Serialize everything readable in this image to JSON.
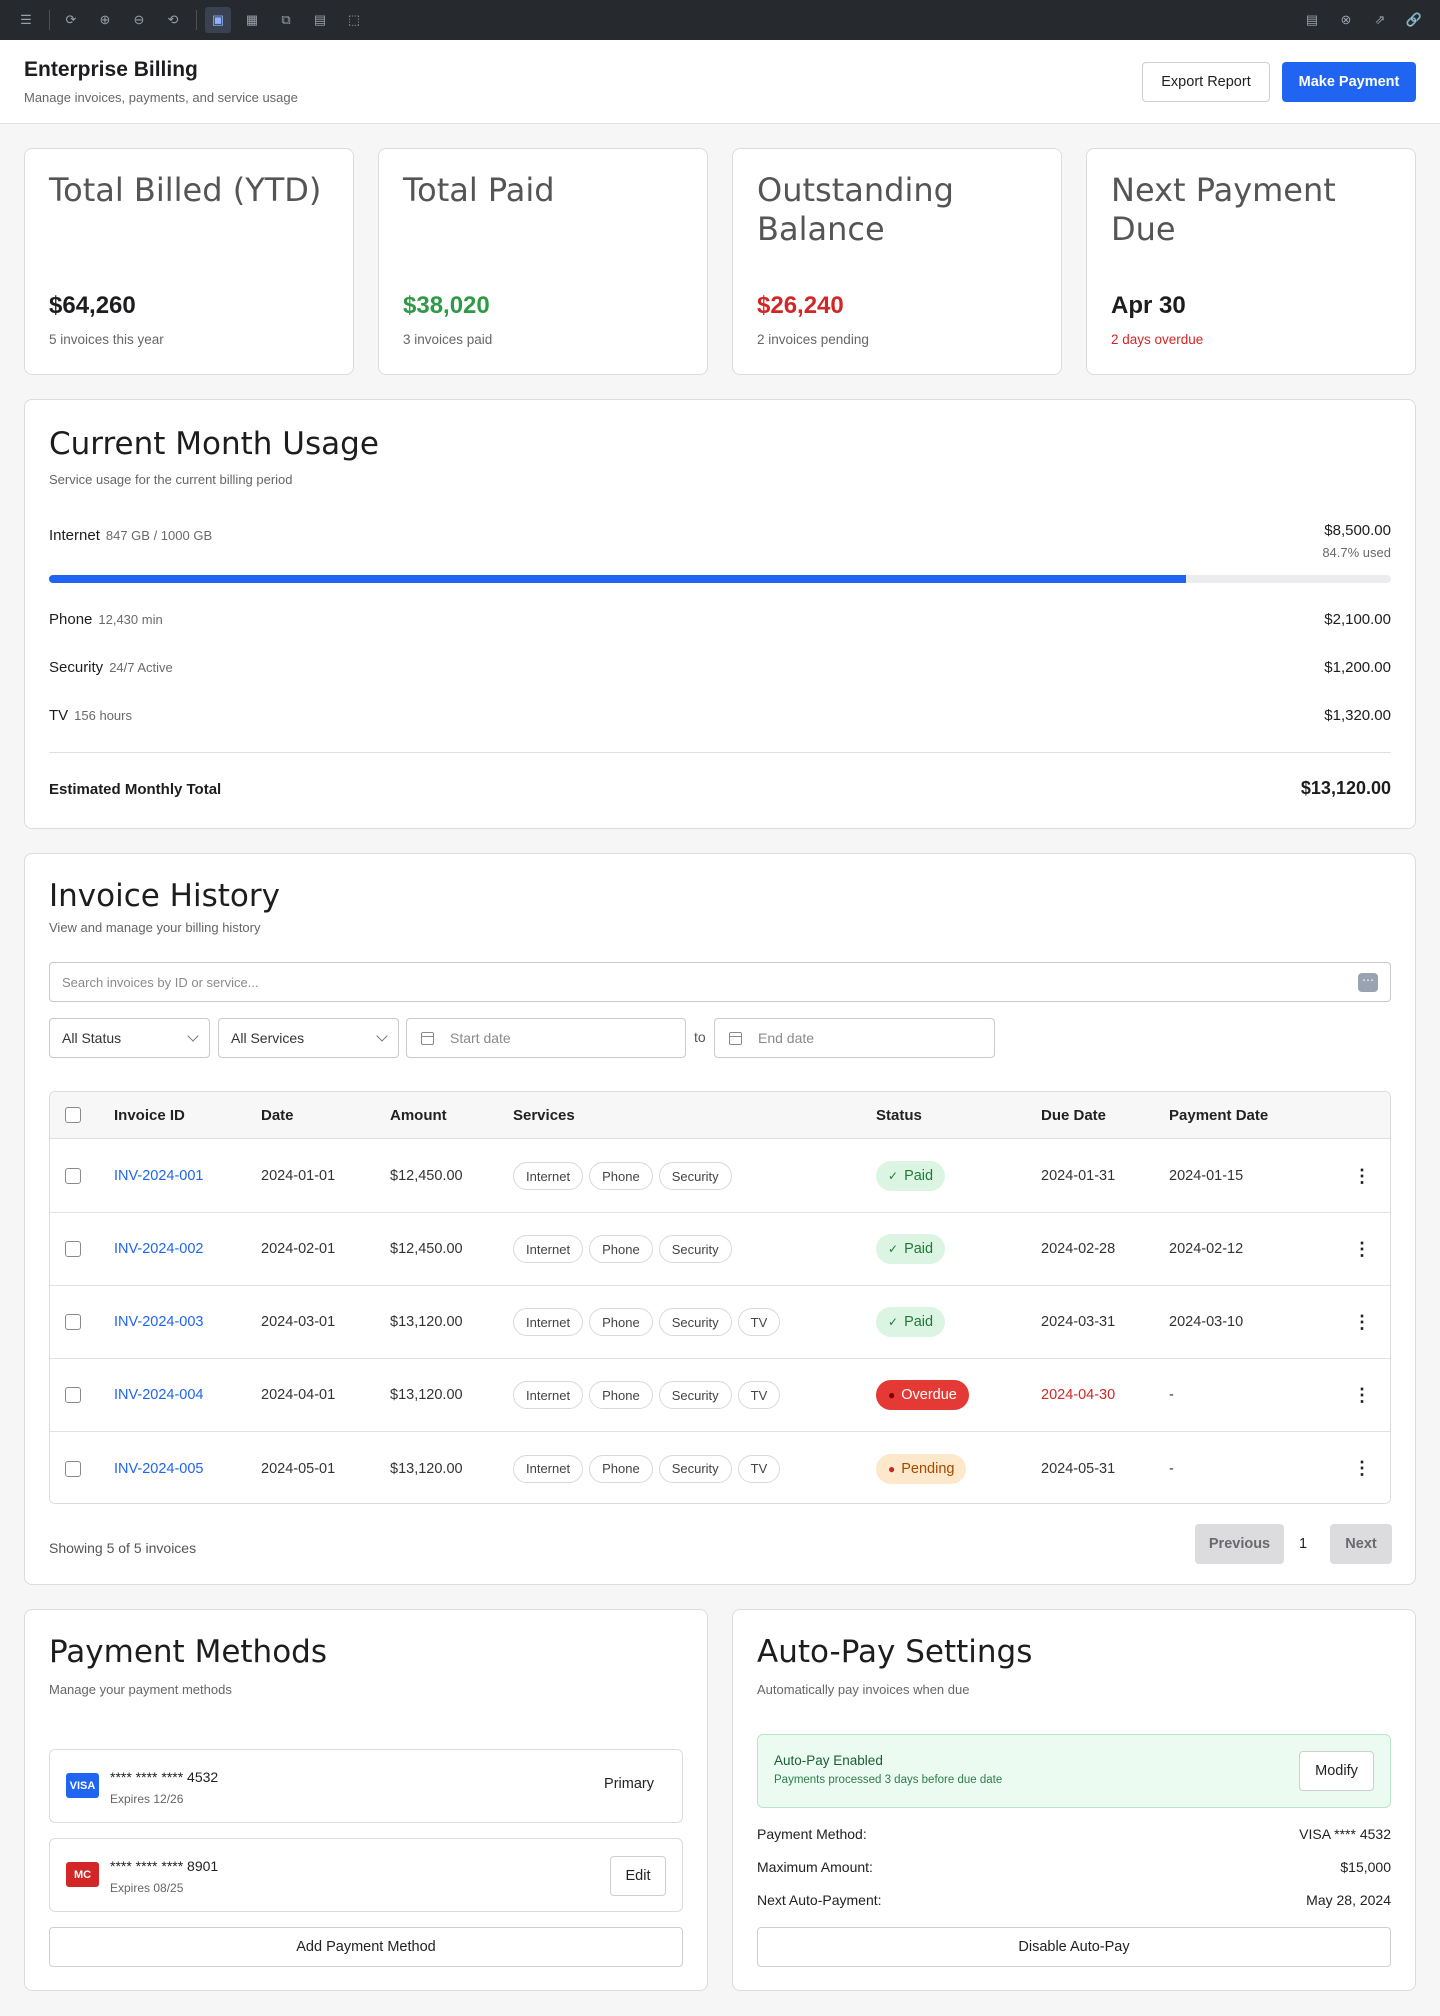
{
  "header": {
    "title": "Enterprise Billing",
    "subtitle": "Manage invoices, payments, and service usage",
    "export_label": "Export Report",
    "pay_label": "Make Payment"
  },
  "stats": [
    {
      "label": "Total Billed (YTD)",
      "value": "$64,260",
      "note": "5 invoices this year"
    },
    {
      "label": "Total Paid",
      "value": "$38,020",
      "note": "3 invoices paid"
    },
    {
      "label": "Outstanding Balance",
      "value": "$26,240",
      "note": "2 invoices pending"
    },
    {
      "label": "Next Payment Due",
      "value": "Apr 30",
      "note": "2 days overdue"
    }
  ],
  "colors": {
    "accent": "#1f65f2",
    "green": "#2e9a47",
    "red": "#d32626"
  },
  "usage": {
    "title": "Current Month Usage",
    "subtitle": "Service usage for the current billing period",
    "internet": {
      "name": "Internet",
      "detail": "847 GB / 1000 GB",
      "amount": "$8,500.00",
      "pct_label": "84.7% used",
      "fraction": 0.847
    },
    "phone": {
      "name": "Phone",
      "detail": "12,430 min",
      "amount": "$2,100.00"
    },
    "security": {
      "name": "Security",
      "detail": "24/7 Active",
      "amount": "$1,200.00"
    },
    "tv": {
      "name": "TV",
      "detail": "156 hours",
      "amount": "$1,320.00"
    },
    "total_label": "Estimated Monthly Total",
    "total": "$13,120.00"
  },
  "invoices": {
    "title": "Invoice History",
    "subtitle": "View and manage your billing history",
    "search_placeholder": "Search invoices by ID or service...",
    "status_filter": "All Status",
    "service_filter": "All Services",
    "start_placeholder": "Start date",
    "end_placeholder": "End date",
    "to_label": "to",
    "columns": [
      "Invoice ID",
      "Date",
      "Amount",
      "Services",
      "Status",
      "Due Date",
      "Payment Date"
    ],
    "rows": [
      {
        "id": "INV-2024-001",
        "date": "2024-01-01",
        "amount": "$12,450.00",
        "services": [
          "Internet",
          "Phone",
          "Security"
        ],
        "status": "Paid",
        "due": "2024-01-31",
        "paid": "2024-01-15"
      },
      {
        "id": "INV-2024-002",
        "date": "2024-02-01",
        "amount": "$12,450.00",
        "services": [
          "Internet",
          "Phone",
          "Security"
        ],
        "status": "Paid",
        "due": "2024-02-28",
        "paid": "2024-02-12"
      },
      {
        "id": "INV-2024-003",
        "date": "2024-03-01",
        "amount": "$13,120.00",
        "services": [
          "Internet",
          "Phone",
          "Security",
          "TV"
        ],
        "status": "Paid",
        "due": "2024-03-31",
        "paid": "2024-03-10"
      },
      {
        "id": "INV-2024-004",
        "date": "2024-04-01",
        "amount": "$13,120.00",
        "services": [
          "Internet",
          "Phone",
          "Security",
          "TV"
        ],
        "status": "Overdue",
        "due": "2024-04-30",
        "paid": "-"
      },
      {
        "id": "INV-2024-005",
        "date": "2024-05-01",
        "amount": "$13,120.00",
        "services": [
          "Internet",
          "Phone",
          "Security",
          "TV"
        ],
        "status": "Pending",
        "due": "2024-05-31",
        "paid": "-"
      }
    ],
    "showing": "Showing 5 of 5 invoices",
    "prev_label": "Previous",
    "page": "1",
    "next_label": "Next"
  },
  "payment_methods": {
    "title": "Payment Methods",
    "subtitle": "Manage your payment methods",
    "cards": [
      {
        "brand": "VISA",
        "number": "**** **** **** 4532",
        "expires": "Expires 12/26",
        "action": "Primary"
      },
      {
        "brand": "MC",
        "number": "**** **** **** 8901",
        "expires": "Expires 08/25",
        "action": "Edit"
      }
    ],
    "add_label": "Add Payment Method"
  },
  "autopay": {
    "title": "Auto-Pay Settings",
    "subtitle": "Automatically pay invoices when due",
    "status_title": "Auto-Pay Enabled",
    "status_note": "Payments processed 3 days before due date",
    "modify_label": "Modify",
    "method_label": "Payment Method:",
    "method_value": "VISA **** 4532",
    "max_label": "Maximum Amount:",
    "max_value": "$15,000",
    "next_label": "Next Auto-Payment:",
    "next_value": "May 28, 2024",
    "disable_label": "Disable Auto-Pay"
  }
}
